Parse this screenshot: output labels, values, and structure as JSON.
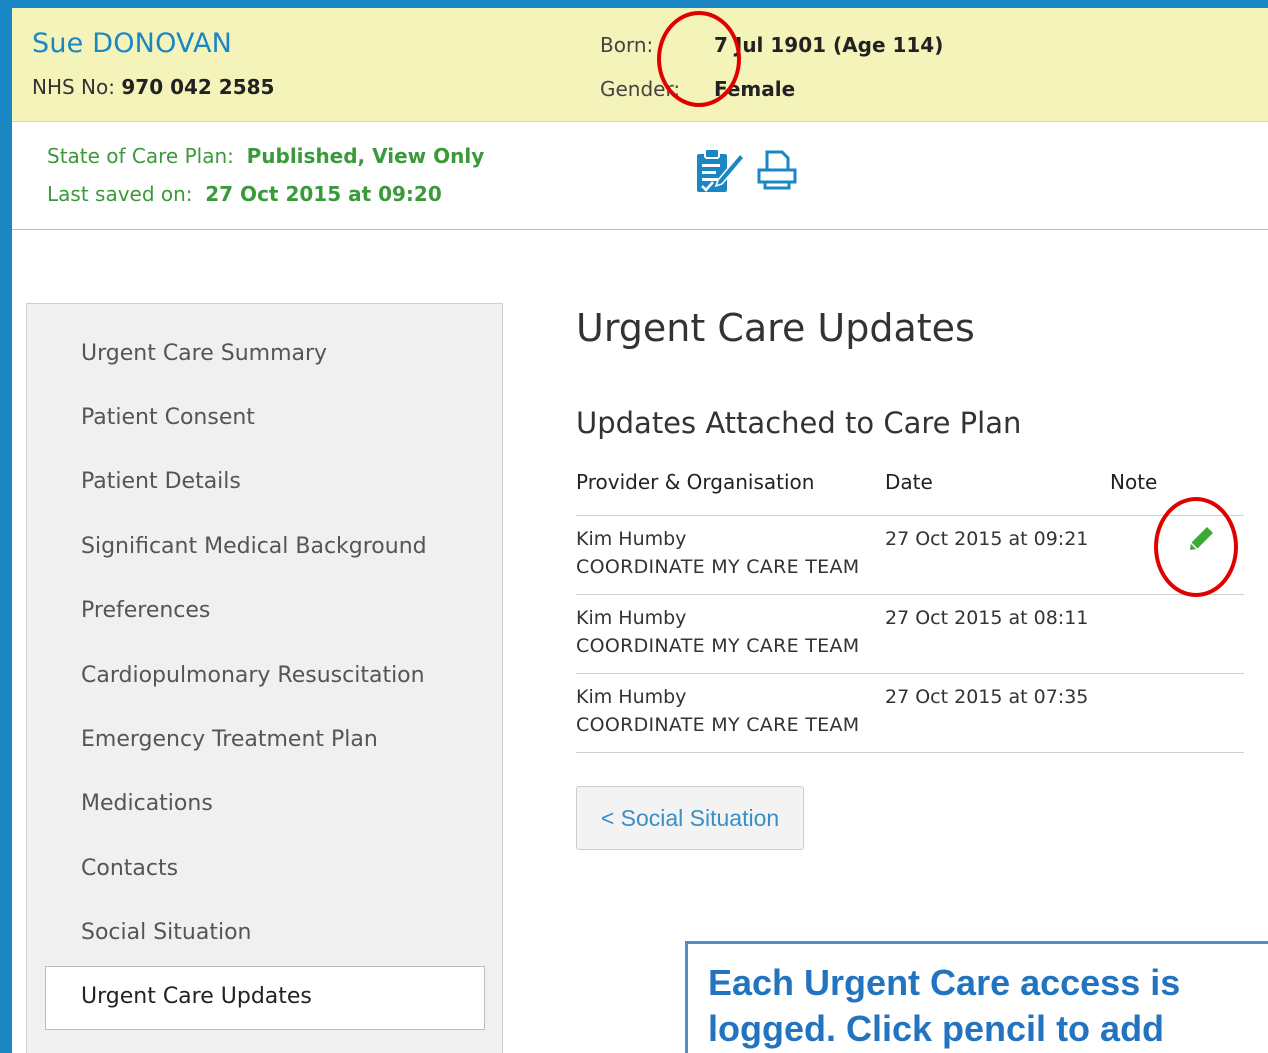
{
  "patient": {
    "name": "Sue DONOVAN",
    "nhs_label": "NHS No:",
    "nhs_number": "970 042 2585",
    "born_label": "Born:",
    "born_value": "7 Jul 1901 (Age 114)",
    "gender_label": "Gender:",
    "gender_value": "Female"
  },
  "care_plan": {
    "state_label": "State of Care Plan:",
    "state_value": "Published, View Only",
    "saved_label": "Last saved on:",
    "saved_value": "27 Oct 2015 at 09:20"
  },
  "toolbar": {
    "icons": [
      "clipboard-edit-icon",
      "print-icon"
    ]
  },
  "sidebar": {
    "items": [
      {
        "label": "Urgent Care Summary"
      },
      {
        "label": "Patient Consent"
      },
      {
        "label": "Patient Details"
      },
      {
        "label": "Significant Medical Background"
      },
      {
        "label": "Preferences"
      },
      {
        "label": "Cardiopulmonary Resuscitation"
      },
      {
        "label": "Emergency Treatment Plan"
      },
      {
        "label": "Medications"
      },
      {
        "label": "Contacts"
      },
      {
        "label": "Social Situation"
      },
      {
        "label": "Urgent Care Updates"
      }
    ]
  },
  "main": {
    "title": "Urgent Care Updates",
    "subtitle": "Updates Attached to Care Plan",
    "table": {
      "headers": [
        "Provider & Organisation",
        "Date",
        "Note"
      ],
      "rows": [
        {
          "name": "Kim Humby",
          "org": "COORDINATE MY CARE TEAM",
          "date": "27 Oct 2015 at 09:21"
        },
        {
          "name": "Kim Humby",
          "org": "COORDINATE MY CARE TEAM",
          "date": "27 Oct 2015 at 08:11"
        },
        {
          "name": "Kim Humby",
          "org": "COORDINATE MY CARE TEAM",
          "date": "27 Oct 2015 at 07:35"
        }
      ]
    },
    "back_button": "< Social Situation"
  },
  "callout": {
    "line1": "Each Urgent Care access is",
    "line2": "logged.  Click pencil to add"
  },
  "colors": {
    "frame_blue": "#1a87c4",
    "banner_yellow": "#f4f3ba",
    "state_green": "#3a9a3a",
    "annotation_red": "#e00000",
    "pencil_green": "#3aaa35"
  }
}
